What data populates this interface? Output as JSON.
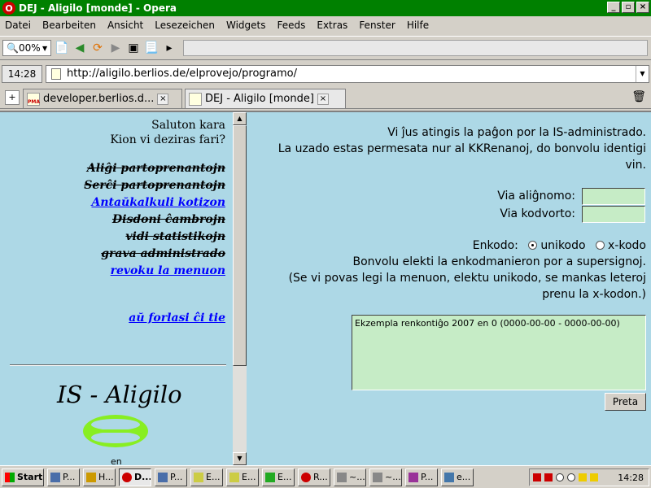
{
  "window": {
    "title": "DEJ - Aligilo [monde] - Opera"
  },
  "menu": [
    "Datei",
    "Bearbeiten",
    "Ansicht",
    "Lesezeichen",
    "Widgets",
    "Feeds",
    "Extras",
    "Fenster",
    "Hilfe"
  ],
  "toolbar": {
    "zoom": "00%"
  },
  "addressbar": {
    "clock": "14:28",
    "url": "http://aligilo.berlios.de/elprovejo/programo/"
  },
  "tabs": [
    {
      "label": "developer.berlios.d..."
    },
    {
      "label": "DEJ - Aligilo [monde]"
    }
  ],
  "left": {
    "greeting": "Saluton kara",
    "question": "Kion vi deziras fari?",
    "links": [
      {
        "label": "Aliĝi partoprenantojn"
      },
      {
        "label": "Serĉi partoprenantojn"
      },
      {
        "label": "Antaŭkalkuli kotizon"
      },
      {
        "label": "Disdoni ĉambrojn"
      },
      {
        "label": "vidi statistikojn"
      },
      {
        "label": "grava administrado"
      },
      {
        "label": "revoku la menuon"
      }
    ],
    "logout": "aŭ forlasi ĉi tie",
    "logo_text": "IS - Aligilo",
    "lang": "en"
  },
  "right": {
    "line1": "Vi ĵus atingis la paĝon por la IS-administrado.",
    "line2": "La uzado estas permesata nur al KKRenanoj, do bonvolu identigi",
    "line3": "vin.",
    "name_label": "Via aliĝnomo:",
    "pass_label": "Via kodvorto:",
    "encoding_label": "Enkodo:",
    "enc_opt1": "unikodo",
    "enc_opt2": "x-kodo",
    "enc_help1": "Bonvolu elekti la enkodmanieron por a supersignoj.",
    "enc_help2": "(Se vi povas legi la menuon, elektu unikodo, se mankas leteroj",
    "enc_help3": "prenu la x-kodon.)",
    "textarea": "Ekzempla renkontiĝo 2007 en 0 (0000-00-00 - 0000-00-00)",
    "submit": "Preta"
  },
  "taskbar": {
    "start": "Start",
    "tasks": [
      "P...",
      "H...",
      "D...",
      "P...",
      "E...",
      "E...",
      "E...",
      "R...",
      "~...",
      "~...",
      "P...",
      "e..."
    ],
    "time": "14:28"
  }
}
